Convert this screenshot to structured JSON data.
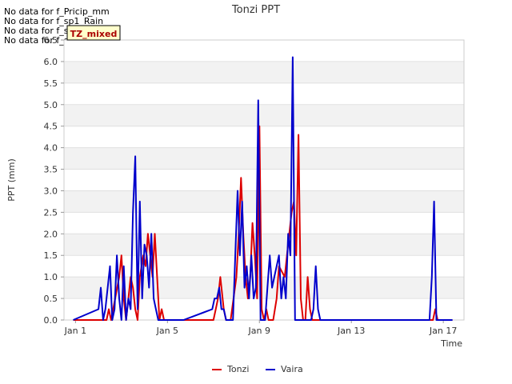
{
  "no_data_notes": [
    "No data for f_Pricip_mm",
    "No data for f_sp1_Rain",
    "No data for f_sp2_Rain",
    "No data for f_sp3_Rain"
  ],
  "badge": {
    "label": "TZ_mixed"
  },
  "chart_data": {
    "type": "line",
    "title": "Tonzi PPT",
    "xlabel": "Time",
    "ylabel": "PPT (mm)",
    "xlim": [
      0.5,
      17.9
    ],
    "ylim": [
      0,
      6.5
    ],
    "yticks": [
      0.0,
      0.5,
      1.0,
      1.5,
      2.0,
      2.5,
      3.0,
      3.5,
      4.0,
      4.5,
      5.0,
      5.5,
      6.0,
      6.5
    ],
    "ytick_labels": [
      "0.0",
      "0.5",
      "1.0",
      "1.5",
      "2.0",
      "2.5",
      "3.0",
      "3.5",
      "4.0",
      "4.5",
      "5.0",
      "5.5",
      "6.0",
      "6.5"
    ],
    "xticks": [
      1,
      5,
      9,
      13,
      17
    ],
    "xtick_labels": [
      "Jan 1",
      "Jan 5",
      "Jan 9",
      "Jan 13",
      "Jan 17"
    ],
    "grid": "horizontal bands",
    "legend_position": "bottom-center",
    "series": [
      {
        "name": "Tonzi",
        "color": "#dd0000",
        "x": [
          0.9,
          2.35,
          2.45,
          2.55,
          2.9,
          3.0,
          3.1,
          3.2,
          3.3,
          3.4,
          3.5,
          3.6,
          3.7,
          3.8,
          3.95,
          4.05,
          4.15,
          4.25,
          4.35,
          4.45,
          4.55,
          4.65,
          4.75,
          4.85,
          4.95,
          5.05,
          5.15,
          5.25,
          5.35,
          5.45,
          5.55,
          7.0,
          7.1,
          7.2,
          7.3,
          7.45,
          7.55,
          7.65,
          7.75,
          8.0,
          8.1,
          8.2,
          8.3,
          8.4,
          8.5,
          8.6,
          8.7,
          8.8,
          8.9,
          9.0,
          9.1,
          9.2,
          9.3,
          9.4,
          9.5,
          9.6,
          9.75,
          9.85,
          10.1,
          10.2,
          10.3,
          10.4,
          10.5,
          10.6,
          10.7,
          10.8,
          10.9,
          11.0,
          11.1,
          11.2,
          11.3,
          11.4,
          11.5,
          11.6,
          11.7,
          16.55,
          16.65,
          16.75,
          17.4
        ],
        "values": [
          0.0,
          0.0,
          0.25,
          0.0,
          1.0,
          1.5,
          0.5,
          0.0,
          0.5,
          1.0,
          0.75,
          0.25,
          0.0,
          1.0,
          1.5,
          1.25,
          2.0,
          1.5,
          1.0,
          2.0,
          1.0,
          0.0,
          0.25,
          0.0,
          0.0,
          0.0,
          0.0,
          0.0,
          0.0,
          0.0,
          0.0,
          0.0,
          0.25,
          0.5,
          1.0,
          0.25,
          0.0,
          0.0,
          0.0,
          1.0,
          2.0,
          3.3,
          2.0,
          1.0,
          0.5,
          1.0,
          2.25,
          1.5,
          0.5,
          4.5,
          0.25,
          0.0,
          0.25,
          0.0,
          0.0,
          0.0,
          0.5,
          1.25,
          1.0,
          1.5,
          2.0,
          2.5,
          2.75,
          1.5,
          4.3,
          0.5,
          0.0,
          0.0,
          1.0,
          0.25,
          0.0,
          0.0,
          0.0,
          0.0,
          0.0,
          0.0,
          0.25,
          0.0,
          0.0
        ]
      },
      {
        "name": "Vaira",
        "color": "#0000cc",
        "x": [
          0.9,
          2.0,
          2.1,
          2.2,
          2.3,
          2.4,
          2.5,
          2.6,
          2.7,
          2.8,
          2.9,
          3.0,
          3.1,
          3.2,
          3.3,
          3.4,
          3.5,
          3.6,
          3.7,
          3.8,
          3.9,
          4.0,
          4.1,
          4.2,
          4.3,
          4.4,
          4.5,
          4.6,
          4.7,
          4.8,
          4.9,
          5.0,
          5.1,
          5.2,
          5.3,
          5.4,
          5.5,
          5.6,
          5.7,
          6.95,
          7.05,
          7.15,
          7.25,
          7.35,
          7.45,
          7.55,
          7.65,
          7.75,
          7.85,
          7.95,
          8.05,
          8.15,
          8.25,
          8.35,
          8.45,
          8.55,
          8.65,
          8.75,
          8.85,
          8.95,
          9.05,
          9.15,
          9.25,
          9.35,
          9.45,
          9.55,
          9.65,
          9.75,
          9.85,
          9.95,
          10.05,
          10.15,
          10.25,
          10.35,
          10.45,
          10.55,
          10.65,
          10.75,
          10.85,
          10.95,
          11.05,
          11.15,
          11.25,
          11.35,
          11.45,
          11.55,
          11.65,
          11.75,
          11.85,
          11.95,
          12.05,
          12.15,
          12.25,
          12.35,
          12.45,
          12.55,
          16.4,
          16.5,
          16.6,
          16.7,
          17.4
        ],
        "values": [
          0.0,
          0.25,
          0.75,
          0.0,
          0.25,
          0.75,
          1.25,
          0.0,
          0.25,
          1.5,
          0.5,
          0.0,
          1.25,
          0.0,
          0.5,
          0.25,
          2.5,
          3.8,
          0.25,
          2.75,
          0.5,
          1.75,
          1.5,
          0.75,
          2.0,
          0.5,
          0.25,
          0.0,
          0.0,
          0.0,
          0.0,
          0.0,
          0.0,
          0.0,
          0.0,
          0.0,
          0.0,
          0.0,
          0.0,
          0.25,
          0.5,
          0.5,
          0.75,
          0.25,
          0.25,
          0.0,
          0.0,
          0.0,
          0.0,
          1.5,
          3.0,
          1.5,
          2.75,
          0.75,
          1.25,
          0.5,
          1.5,
          0.5,
          0.75,
          5.1,
          0.0,
          0.0,
          0.0,
          0.75,
          1.5,
          0.75,
          1.0,
          1.25,
          1.5,
          0.5,
          1.0,
          0.5,
          2.0,
          1.5,
          6.1,
          0.0,
          0.0,
          0.0,
          0.0,
          0.0,
          0.0,
          0.0,
          0.0,
          0.25,
          1.25,
          0.25,
          0.0,
          0.0,
          0.0,
          0.0,
          0.0,
          0.0,
          0.0,
          0.0,
          0.0,
          0.0,
          0.0,
          1.0,
          2.75,
          0.0,
          0.0
        ]
      }
    ]
  }
}
